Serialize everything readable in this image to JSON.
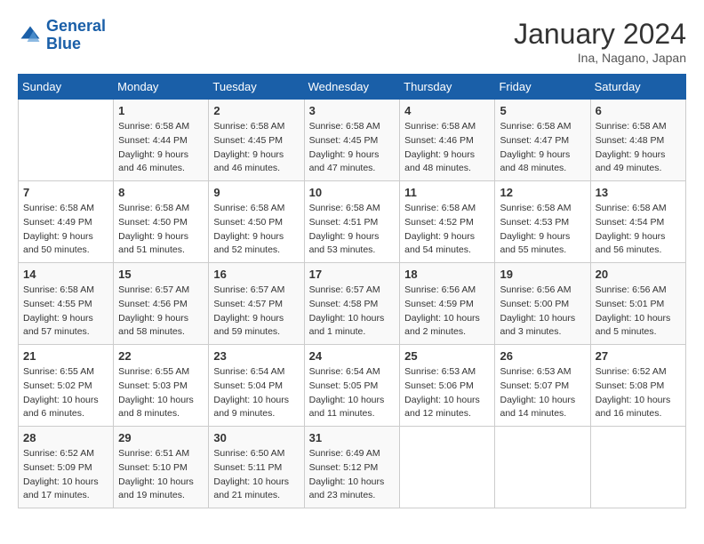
{
  "logo": {
    "line1": "General",
    "line2": "Blue"
  },
  "title": "January 2024",
  "subtitle": "Ina, Nagano, Japan",
  "days_of_week": [
    "Sunday",
    "Monday",
    "Tuesday",
    "Wednesday",
    "Thursday",
    "Friday",
    "Saturday"
  ],
  "weeks": [
    [
      {
        "day": "",
        "sunrise": "",
        "sunset": "",
        "daylight": ""
      },
      {
        "day": "1",
        "sunrise": "Sunrise: 6:58 AM",
        "sunset": "Sunset: 4:44 PM",
        "daylight": "Daylight: 9 hours and 46 minutes."
      },
      {
        "day": "2",
        "sunrise": "Sunrise: 6:58 AM",
        "sunset": "Sunset: 4:45 PM",
        "daylight": "Daylight: 9 hours and 46 minutes."
      },
      {
        "day": "3",
        "sunrise": "Sunrise: 6:58 AM",
        "sunset": "Sunset: 4:45 PM",
        "daylight": "Daylight: 9 hours and 47 minutes."
      },
      {
        "day": "4",
        "sunrise": "Sunrise: 6:58 AM",
        "sunset": "Sunset: 4:46 PM",
        "daylight": "Daylight: 9 hours and 48 minutes."
      },
      {
        "day": "5",
        "sunrise": "Sunrise: 6:58 AM",
        "sunset": "Sunset: 4:47 PM",
        "daylight": "Daylight: 9 hours and 48 minutes."
      },
      {
        "day": "6",
        "sunrise": "Sunrise: 6:58 AM",
        "sunset": "Sunset: 4:48 PM",
        "daylight": "Daylight: 9 hours and 49 minutes."
      }
    ],
    [
      {
        "day": "7",
        "sunrise": "Sunrise: 6:58 AM",
        "sunset": "Sunset: 4:49 PM",
        "daylight": "Daylight: 9 hours and 50 minutes."
      },
      {
        "day": "8",
        "sunrise": "Sunrise: 6:58 AM",
        "sunset": "Sunset: 4:50 PM",
        "daylight": "Daylight: 9 hours and 51 minutes."
      },
      {
        "day": "9",
        "sunrise": "Sunrise: 6:58 AM",
        "sunset": "Sunset: 4:50 PM",
        "daylight": "Daylight: 9 hours and 52 minutes."
      },
      {
        "day": "10",
        "sunrise": "Sunrise: 6:58 AM",
        "sunset": "Sunset: 4:51 PM",
        "daylight": "Daylight: 9 hours and 53 minutes."
      },
      {
        "day": "11",
        "sunrise": "Sunrise: 6:58 AM",
        "sunset": "Sunset: 4:52 PM",
        "daylight": "Daylight: 9 hours and 54 minutes."
      },
      {
        "day": "12",
        "sunrise": "Sunrise: 6:58 AM",
        "sunset": "Sunset: 4:53 PM",
        "daylight": "Daylight: 9 hours and 55 minutes."
      },
      {
        "day": "13",
        "sunrise": "Sunrise: 6:58 AM",
        "sunset": "Sunset: 4:54 PM",
        "daylight": "Daylight: 9 hours and 56 minutes."
      }
    ],
    [
      {
        "day": "14",
        "sunrise": "Sunrise: 6:58 AM",
        "sunset": "Sunset: 4:55 PM",
        "daylight": "Daylight: 9 hours and 57 minutes."
      },
      {
        "day": "15",
        "sunrise": "Sunrise: 6:57 AM",
        "sunset": "Sunset: 4:56 PM",
        "daylight": "Daylight: 9 hours and 58 minutes."
      },
      {
        "day": "16",
        "sunrise": "Sunrise: 6:57 AM",
        "sunset": "Sunset: 4:57 PM",
        "daylight": "Daylight: 9 hours and 59 minutes."
      },
      {
        "day": "17",
        "sunrise": "Sunrise: 6:57 AM",
        "sunset": "Sunset: 4:58 PM",
        "daylight": "Daylight: 10 hours and 1 minute."
      },
      {
        "day": "18",
        "sunrise": "Sunrise: 6:56 AM",
        "sunset": "Sunset: 4:59 PM",
        "daylight": "Daylight: 10 hours and 2 minutes."
      },
      {
        "day": "19",
        "sunrise": "Sunrise: 6:56 AM",
        "sunset": "Sunset: 5:00 PM",
        "daylight": "Daylight: 10 hours and 3 minutes."
      },
      {
        "day": "20",
        "sunrise": "Sunrise: 6:56 AM",
        "sunset": "Sunset: 5:01 PM",
        "daylight": "Daylight: 10 hours and 5 minutes."
      }
    ],
    [
      {
        "day": "21",
        "sunrise": "Sunrise: 6:55 AM",
        "sunset": "Sunset: 5:02 PM",
        "daylight": "Daylight: 10 hours and 6 minutes."
      },
      {
        "day": "22",
        "sunrise": "Sunrise: 6:55 AM",
        "sunset": "Sunset: 5:03 PM",
        "daylight": "Daylight: 10 hours and 8 minutes."
      },
      {
        "day": "23",
        "sunrise": "Sunrise: 6:54 AM",
        "sunset": "Sunset: 5:04 PM",
        "daylight": "Daylight: 10 hours and 9 minutes."
      },
      {
        "day": "24",
        "sunrise": "Sunrise: 6:54 AM",
        "sunset": "Sunset: 5:05 PM",
        "daylight": "Daylight: 10 hours and 11 minutes."
      },
      {
        "day": "25",
        "sunrise": "Sunrise: 6:53 AM",
        "sunset": "Sunset: 5:06 PM",
        "daylight": "Daylight: 10 hours and 12 minutes."
      },
      {
        "day": "26",
        "sunrise": "Sunrise: 6:53 AM",
        "sunset": "Sunset: 5:07 PM",
        "daylight": "Daylight: 10 hours and 14 minutes."
      },
      {
        "day": "27",
        "sunrise": "Sunrise: 6:52 AM",
        "sunset": "Sunset: 5:08 PM",
        "daylight": "Daylight: 10 hours and 16 minutes."
      }
    ],
    [
      {
        "day": "28",
        "sunrise": "Sunrise: 6:52 AM",
        "sunset": "Sunset: 5:09 PM",
        "daylight": "Daylight: 10 hours and 17 minutes."
      },
      {
        "day": "29",
        "sunrise": "Sunrise: 6:51 AM",
        "sunset": "Sunset: 5:10 PM",
        "daylight": "Daylight: 10 hours and 19 minutes."
      },
      {
        "day": "30",
        "sunrise": "Sunrise: 6:50 AM",
        "sunset": "Sunset: 5:11 PM",
        "daylight": "Daylight: 10 hours and 21 minutes."
      },
      {
        "day": "31",
        "sunrise": "Sunrise: 6:49 AM",
        "sunset": "Sunset: 5:12 PM",
        "daylight": "Daylight: 10 hours and 23 minutes."
      },
      {
        "day": "",
        "sunrise": "",
        "sunset": "",
        "daylight": ""
      },
      {
        "day": "",
        "sunrise": "",
        "sunset": "",
        "daylight": ""
      },
      {
        "day": "",
        "sunrise": "",
        "sunset": "",
        "daylight": ""
      }
    ]
  ]
}
